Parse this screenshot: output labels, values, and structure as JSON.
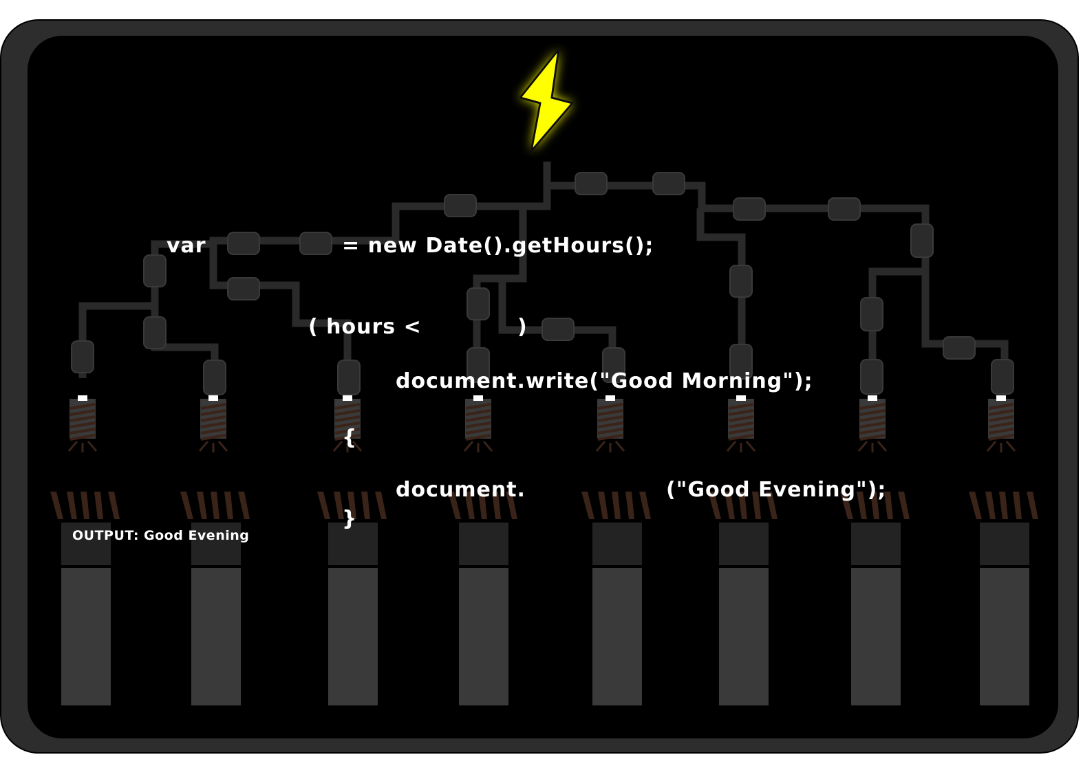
{
  "game": {
    "code_line_1_keyword": "var",
    "code_line_1_rest": "= new Date().getHours();",
    "code_line_2_open": "( hours <",
    "code_line_2_close": ")",
    "code_line_3": "document.write(\"Good Morning\");",
    "code_line_4_brace_open": "{",
    "code_line_5_prefix": "document.",
    "code_line_5_suffix": "(\"Good Evening\");",
    "code_line_6_brace_close": "}",
    "output_label": "OUTPUT: Good Evening"
  },
  "colors": {
    "screen_bg": "#000000",
    "frame": "#2d2d2d",
    "wire": "#2a2a2a",
    "bolt": "#ffff00",
    "coil": "#3a2318",
    "text": "#ffffff"
  },
  "icons": {
    "power_source": "lightning-bolt-icon",
    "bulbs": "light-bulb-icon",
    "sockets": "battery-socket-icon"
  }
}
